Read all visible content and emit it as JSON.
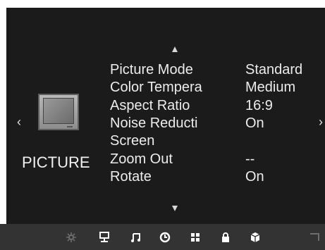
{
  "osd": {
    "category": "PICTURE",
    "nav_left": "‹",
    "nav_right": "›",
    "items": [
      {
        "label": "Picture Mode",
        "value": "Standard"
      },
      {
        "label": "Color Tempera",
        "value": "Medium"
      },
      {
        "label": "Aspect Ratio",
        "value": "16:9"
      },
      {
        "label": "Noise Reducti",
        "value": "On"
      },
      {
        "label": "Screen",
        "value": ""
      },
      {
        "label": "Zoom Out",
        "value": "--"
      },
      {
        "label": "Rotate",
        "value": "On"
      }
    ]
  },
  "bottom_bar": {
    "icons": [
      "gear-icon",
      "network-icon",
      "music-icon",
      "clock-icon",
      "grid-icon",
      "lock-icon",
      "package-icon",
      "corner-icon"
    ]
  }
}
